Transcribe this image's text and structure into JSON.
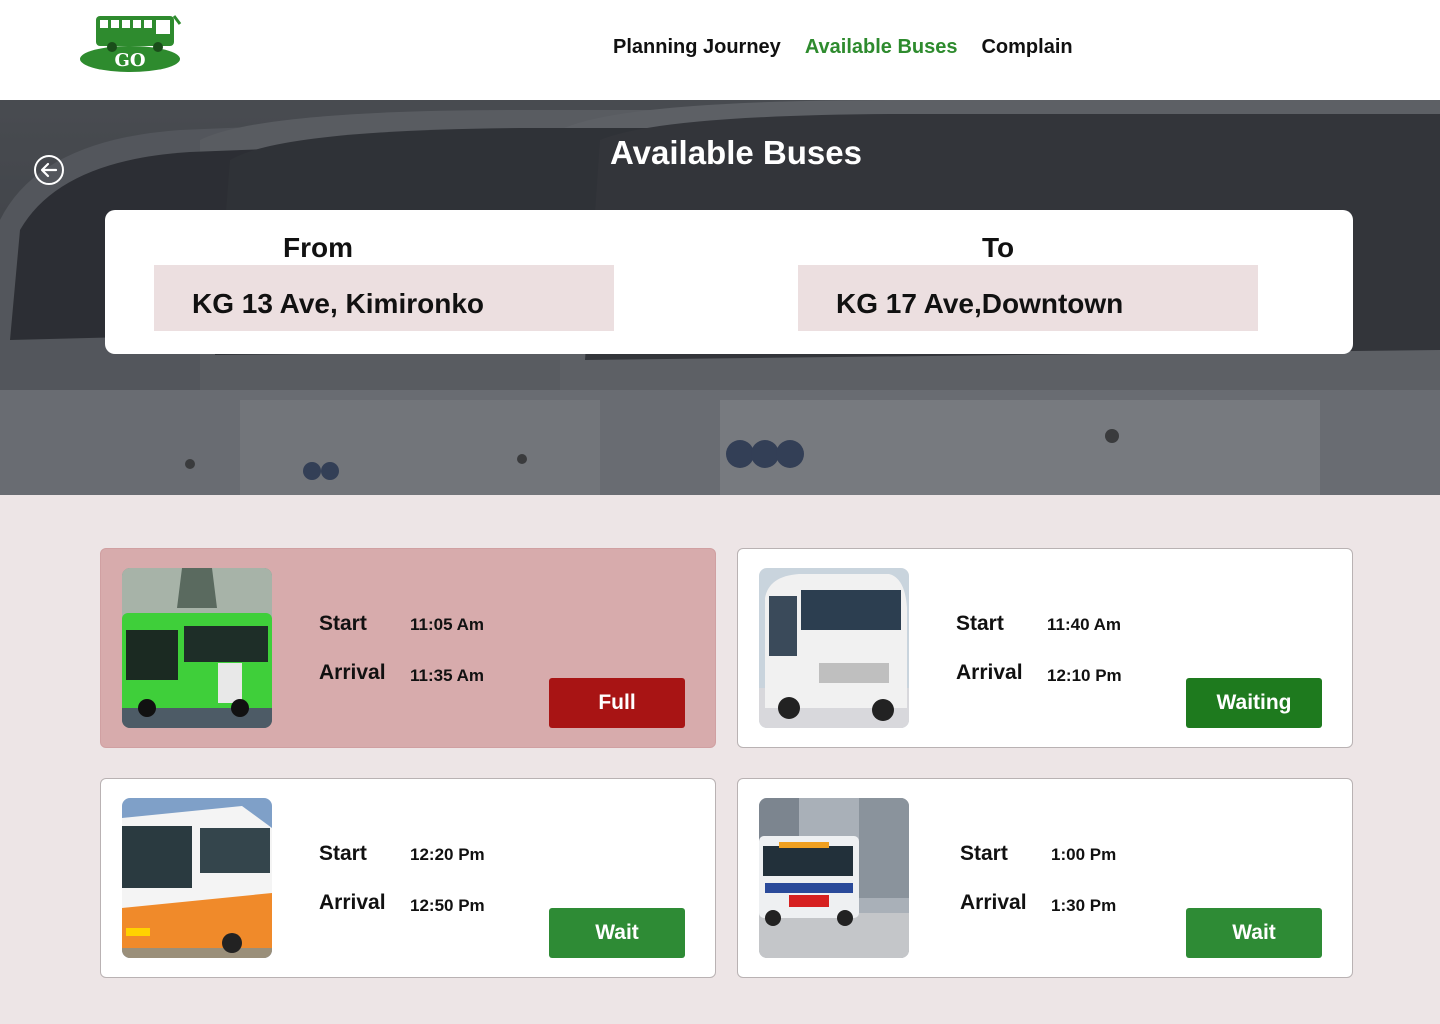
{
  "header": {
    "logo_text": "GO",
    "nav": [
      {
        "label": "Planning Journey",
        "active": false
      },
      {
        "label": "Available Buses",
        "active": true
      },
      {
        "label": "Complain",
        "active": false
      }
    ]
  },
  "hero": {
    "title": "Available Buses",
    "from_label": "From",
    "from_value": "KG 13 Ave, Kimironko",
    "to_label": "To",
    "to_value": "KG 17 Ave,Downtown"
  },
  "buses": [
    {
      "start_label": "Start",
      "start_time": "11:05 Am",
      "arrival_label": "Arrival",
      "arrival_time": "11:35 Am",
      "status": "Full"
    },
    {
      "start_label": "Start",
      "start_time": "11:40 Am",
      "arrival_label": "Arrival",
      "arrival_time": "12:10 Pm",
      "status": "Waiting"
    },
    {
      "start_label": "Start",
      "start_time": "12:20 Pm",
      "arrival_label": "Arrival",
      "arrival_time": "12:50 Pm",
      "status": "Wait"
    },
    {
      "start_label": "Start",
      "start_time": "1:00 Pm",
      "arrival_label": "Arrival",
      "arrival_time": "1:30 Pm",
      "status": "Wait"
    }
  ],
  "colors": {
    "accent_green": "#2e8b2e",
    "full_red": "#a81414",
    "full_card_bg": "#d7abac",
    "field_bg": "#ecdfe0",
    "page_bg": "#ede5e6"
  }
}
